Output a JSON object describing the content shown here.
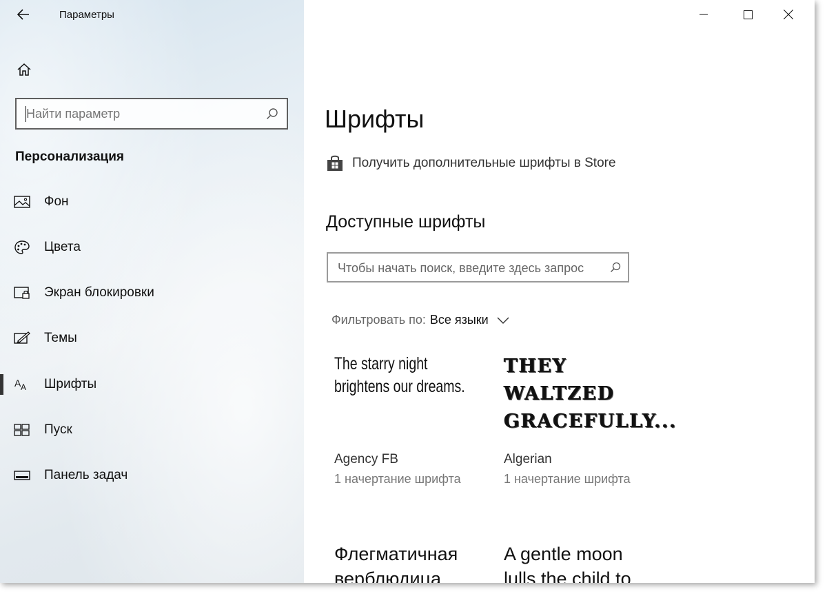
{
  "window": {
    "title": "Параметры",
    "controls": {
      "minimize": "—",
      "maximize": "☐",
      "close": "✕"
    }
  },
  "sidebar": {
    "search_placeholder": "Найти параметр",
    "section_title": "Персонализация",
    "items": [
      {
        "label": "Фон",
        "icon": "picture-icon",
        "active": false
      },
      {
        "label": "Цвета",
        "icon": "palette-icon",
        "active": false
      },
      {
        "label": "Экран блокировки",
        "icon": "lock-screen-icon",
        "active": false
      },
      {
        "label": "Темы",
        "icon": "themes-icon",
        "active": false
      },
      {
        "label": "Шрифты",
        "icon": "font-icon",
        "active": true
      },
      {
        "label": "Пуск",
        "icon": "start-icon",
        "active": false
      },
      {
        "label": "Панель задач",
        "icon": "taskbar-icon",
        "active": false
      }
    ]
  },
  "main": {
    "page_title": "Шрифты",
    "store_link": "Получить дополнительные шрифты в Store",
    "available_title": "Доступные шрифты",
    "font_search_placeholder": "Чтобы начать поиск, введите здесь запрос",
    "filter": {
      "label": "Фильтровать по:",
      "value": "Все языки"
    },
    "fonts": [
      {
        "preview": "The starry night\nbrightens our dreams.",
        "name": "Agency FB",
        "styles": "1 начертание шрифта"
      },
      {
        "preview": "THEY\nWALTZED\nGRACEFULLY...",
        "name": "Algerian",
        "styles": "1 начертание шрифта"
      },
      {
        "preview": "Флегматичная\nверблюдица",
        "name": "",
        "styles": ""
      },
      {
        "preview": "A gentle moon\nlulls the child to",
        "name": "",
        "styles": ""
      }
    ]
  },
  "colors": {
    "accent": "#333333",
    "sidebar_bg": "#e6eef4"
  }
}
